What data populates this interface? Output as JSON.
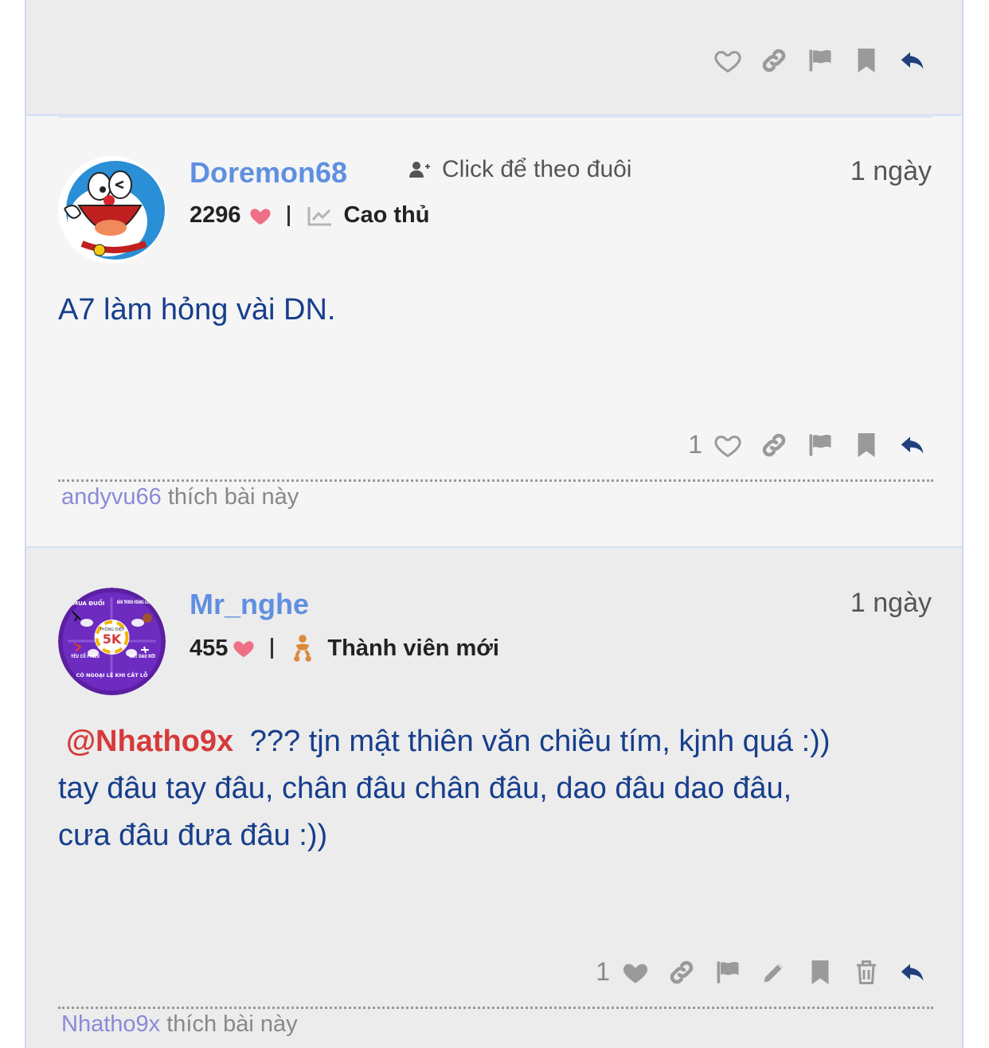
{
  "posts": [
    {
      "id": "top",
      "actions": [
        "heart-outline-icon",
        "link-icon",
        "flag-icon",
        "bookmark-icon",
        "reply-icon"
      ]
    },
    {
      "id": "p1",
      "username": "Doremon68",
      "follow_label": "Click để theo đuôi",
      "time": "1 ngày",
      "points": "2296",
      "rank": "Cao thủ",
      "rank_icon": "chart-line-icon",
      "content": "A7 làm hỏng vài DN.",
      "like_count": "1",
      "liker": "andyvu66",
      "liked_text": "thích bài này"
    },
    {
      "id": "p2",
      "username": "Mr_nghe",
      "time": "1 ngày",
      "points": "455",
      "rank": "Thành viên mới",
      "rank_icon": "baby-icon",
      "mention": "@Nhatho9x",
      "content_line1": "??? tjn mật thiên văn chiều tím, kjnh quá :))",
      "content_line2": "tay đâu tay đâu, chân đâu chân đâu, dao đâu dao đâu,",
      "content_line3": "cưa đâu đưa đâu :))",
      "like_count": "1",
      "liker": "Nhatho9x",
      "liked_text": "thích bài này",
      "avatar_text": {
        "tl": "MUA ĐUỔI",
        "tr": "BÁN TRONG HOẢNG LOẠN",
        "center_top": "THÔNG ĐIỆP",
        "center": "5K",
        "bl": "YÊU CỔ PHIẾU",
        "br": "BẮT DAO RƠI",
        "bottom": "CÓ NGOẠI LỆ KHI CẮT LỖ"
      }
    }
  ],
  "colors": {
    "accent": "#5f8fe0",
    "content": "#173e8c",
    "mention": "#d63a3a",
    "heart": "#ef6f86",
    "reply": "#1f3f7d",
    "icon_gray": "#9a9a9a"
  }
}
